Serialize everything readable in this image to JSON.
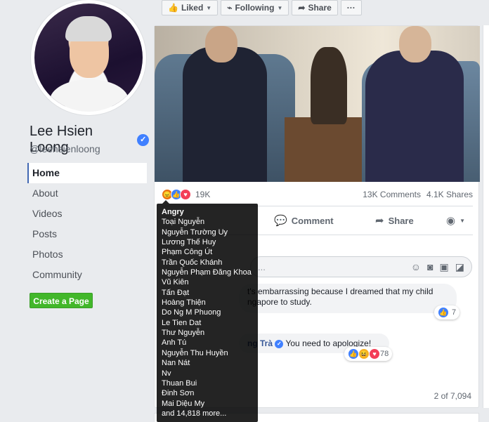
{
  "profile": {
    "name": "Lee Hsien Loong",
    "handle": "@leehsienloong",
    "verified_mark": "✓"
  },
  "nav": {
    "items": [
      "Home",
      "About",
      "Videos",
      "Posts",
      "Photos",
      "Community"
    ],
    "active": "Home"
  },
  "create_page_label": "Create a Page",
  "top_actions": {
    "liked": "Liked",
    "following": "Following",
    "share": "Share",
    "more": "···"
  },
  "post": {
    "reaction_count": "19K",
    "comments": "13K Comments",
    "shares": "4.1K Shares",
    "actions": {
      "comment": "Comment",
      "share": "Share"
    },
    "comment_placeholder": "...",
    "comment1_text": "t's embarrassing because I dreamed that my child ngapore to study.",
    "comment1_line1": "t's embarrassing because I dreamed that my child",
    "comment1_line2": "ngapore to study.",
    "comment1_reacts": "7",
    "comment2_name": "ng Trà",
    "comment2_text": "You need to apologize!",
    "comment2_reacts": "78",
    "pager": "2 of 7,094"
  },
  "tooltip": {
    "title": "Angry",
    "names": [
      "Toại Nguyễn",
      "Nguyễn Trường Uy",
      "Lương Thế Huy",
      "Phạm Công Út",
      "Trần Quốc Khánh",
      "Nguyễn Phạm Đăng Khoa",
      "Vũ Kiên",
      "Tấn Đạt",
      "Hoàng Thiện",
      "Do Ng M Phuong",
      "Le Tien Dat",
      "Thư Nguyễn",
      "Anh Tú",
      "Nguyễn Thu Huyền",
      "Nan Nát",
      "Nv",
      "Thuan Bui",
      "Đinh Sơn",
      "Mai Diệu My"
    ],
    "more": "and 14,818 more..."
  },
  "colors": {
    "accent": "#4267b2",
    "create_button": "#42b72a",
    "angry": "#e9710f",
    "like": "#4080ff",
    "love": "#f33e58"
  }
}
